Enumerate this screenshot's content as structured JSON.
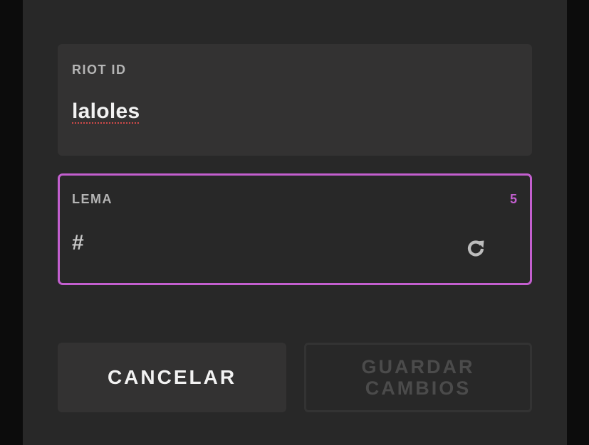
{
  "riot_id": {
    "label": "RIOT ID",
    "value": "laloles"
  },
  "tagline": {
    "label": "LEMA",
    "char_count": "5",
    "prefix": "#",
    "value": "",
    "refresh_icon": "refresh-icon"
  },
  "actions": {
    "cancel_label": "CANCELAR",
    "save_label": "GUARDAR CAMBIOS"
  },
  "colors": {
    "accent": "#c35fcf",
    "panel": "#282828",
    "field": "#333232",
    "spellcheck": "#d24a4a"
  }
}
